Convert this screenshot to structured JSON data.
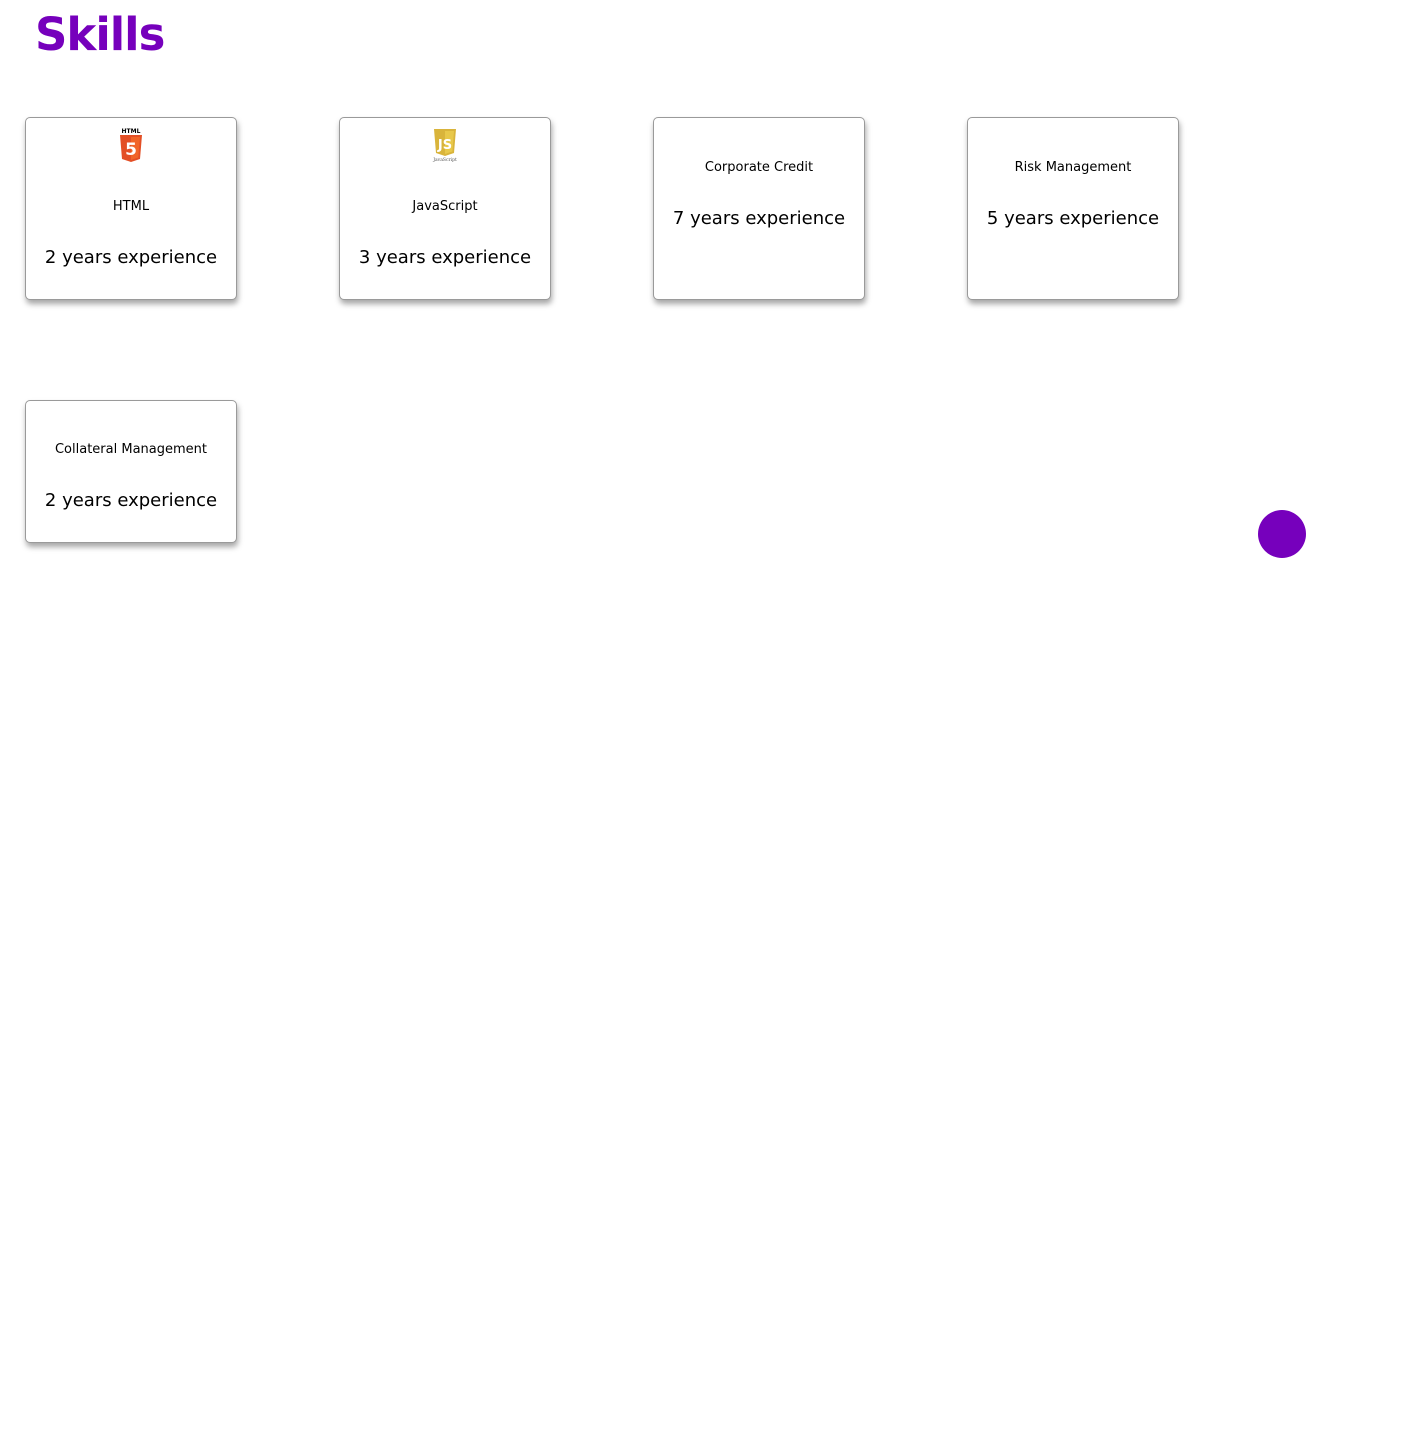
{
  "colors": {
    "accent": "#7600bc",
    "html5_orange": "#e34f26",
    "js_yellow": "#d9b43b"
  },
  "header": {
    "title": "Skills"
  },
  "skills": [
    {
      "name": "HTML",
      "experience": "2 years experience",
      "icon": "html5-icon"
    },
    {
      "name": "JavaScript",
      "experience": "3 years experience",
      "icon": "javascript-icon"
    },
    {
      "name": "Corporate Credit",
      "experience": "7 years experience",
      "icon": null
    },
    {
      "name": "Risk Management",
      "experience": "5 years experience",
      "icon": null
    },
    {
      "name": "Collateral Management",
      "experience": "2 years experience",
      "icon": null
    }
  ],
  "fab": {
    "icon": "circle"
  }
}
